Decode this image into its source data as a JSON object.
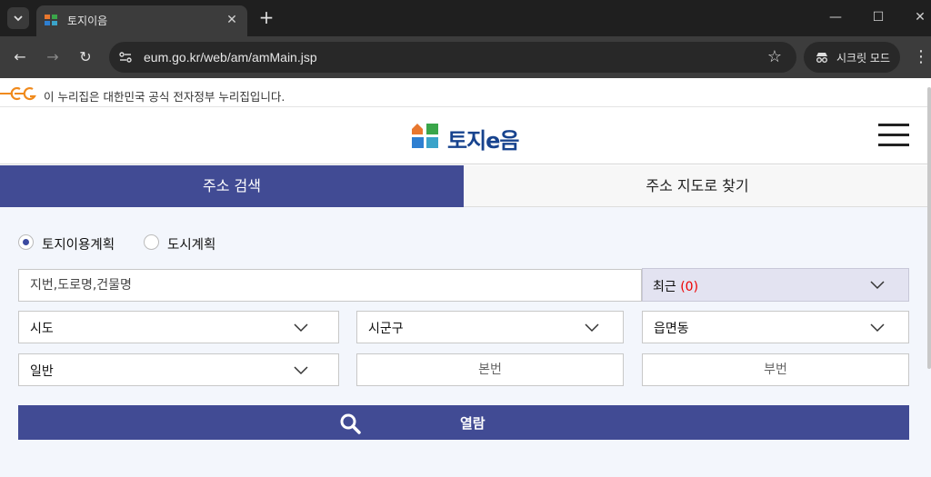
{
  "browser": {
    "tab_title": "토지이음",
    "url": "eum.go.kr/web/am/amMain.jsp",
    "incognito_label": "시크릿 모드"
  },
  "page": {
    "gov_banner": "이 누리집은 대한민국 공식 전자정부 누리집입니다.",
    "logo_text": "토지e음",
    "tabs": [
      {
        "label": "주소 검색",
        "active": true
      },
      {
        "label": "주소 지도로 찾기",
        "active": false
      }
    ],
    "radios": [
      {
        "label": "토지이용계획",
        "checked": true
      },
      {
        "label": "도시계획",
        "checked": false
      }
    ],
    "address_placeholder": "지번,도로명,건물명",
    "recent_label": "최근",
    "recent_count": "(0)",
    "selects": {
      "sido": "시도",
      "sigungu": "시군구",
      "eupmyeondong": "읍면동",
      "land_type": "일반"
    },
    "bonbeon_placeholder": "본번",
    "bubeon_placeholder": "부번",
    "open_button": "열람"
  },
  "colors": {
    "primary": "#414b94",
    "recent_count": "#e00000",
    "search_bg": "#f3f6fc"
  }
}
